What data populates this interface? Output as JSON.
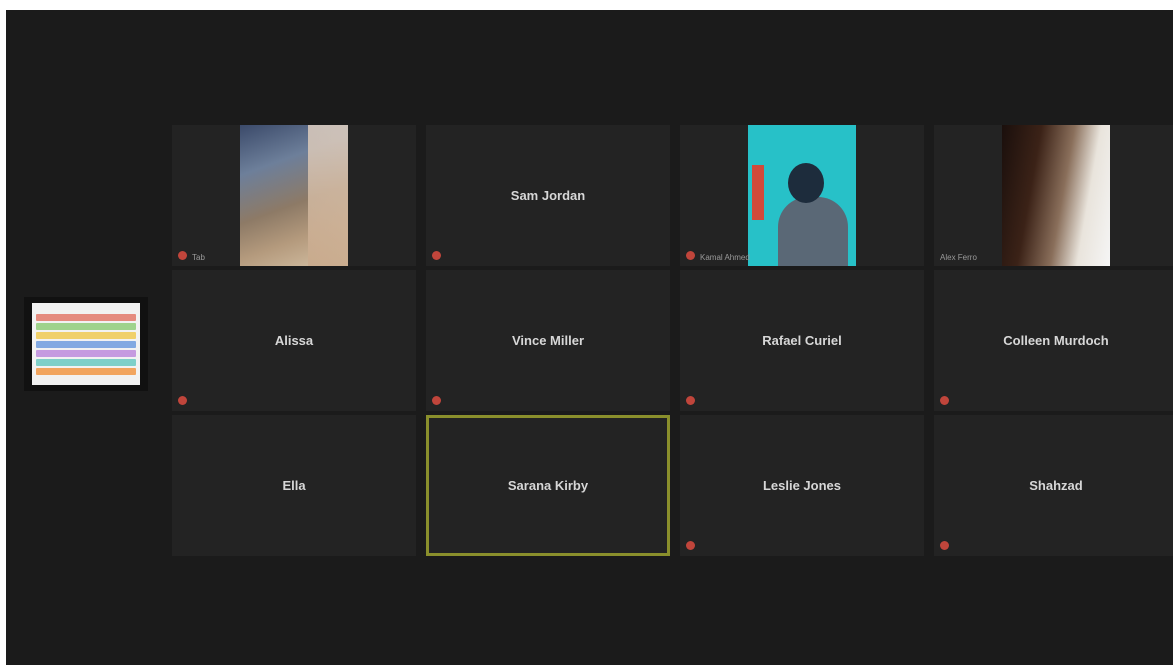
{
  "meeting": {
    "tiles": [
      {
        "name": "",
        "label": "Tab",
        "type": "video",
        "muted": true
      },
      {
        "name": "Sam Jordan",
        "label": "",
        "type": "name",
        "muted": true
      },
      {
        "name": "",
        "label": "Kamal Ahmed",
        "type": "video",
        "muted": true
      },
      {
        "name": "",
        "label": "Alex Ferro",
        "type": "video",
        "muted": false
      },
      {
        "name": "Alissa",
        "label": "",
        "type": "name",
        "muted": true
      },
      {
        "name": "Vince Miller",
        "label": "",
        "type": "name",
        "muted": true
      },
      {
        "name": "Rafael Curiel",
        "label": "",
        "type": "name",
        "muted": true
      },
      {
        "name": "Colleen Murdoch",
        "label": "",
        "type": "name",
        "muted": true
      },
      {
        "name": "Ella",
        "label": "",
        "type": "name",
        "muted": false
      },
      {
        "name": "Sarana Kirby",
        "label": "",
        "type": "name",
        "muted": false,
        "active": true
      },
      {
        "name": "Leslie Jones",
        "label": "",
        "type": "name",
        "muted": true
      },
      {
        "name": "Shahzad",
        "label": "",
        "type": "name",
        "muted": true
      }
    ],
    "share_colors": [
      "#e58b7f",
      "#9fd38c",
      "#f0d06a",
      "#82a9e2",
      "#c59be0",
      "#7fd0c9",
      "#f2a55f"
    ],
    "active_outline_color": "#8a8f2c",
    "mute_icon_color": "#c0453b"
  }
}
